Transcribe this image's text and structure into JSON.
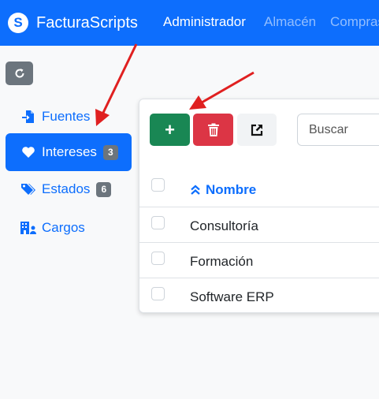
{
  "navbar": {
    "brand_name": "FacturaScripts",
    "items": [
      {
        "label": "Administrador",
        "active": true
      },
      {
        "label": "Almacén",
        "active": false
      },
      {
        "label": "Compras",
        "active": false
      }
    ]
  },
  "sidebar": {
    "items": [
      {
        "label": "Fuentes",
        "icon": "file-import-icon",
        "badge": "",
        "active": false
      },
      {
        "label": "Intereses",
        "icon": "heart-icon",
        "badge": "3",
        "active": true
      },
      {
        "label": "Estados",
        "icon": "tags-icon",
        "badge": "6",
        "active": false
      },
      {
        "label": "Cargos",
        "icon": "building-user-icon",
        "badge": "",
        "active": false
      }
    ]
  },
  "toolbar": {
    "add_label": "+",
    "search_placeholder": "Buscar"
  },
  "table": {
    "header": "Nombre",
    "sort": "ascending",
    "rows": [
      "Consultoría",
      "Formación",
      "Software ERP"
    ]
  },
  "colors": {
    "primary": "#0d6efd",
    "success": "#198754",
    "danger": "#dc3545",
    "secondary": "#6c757d",
    "annotation_arrow": "#e02020"
  }
}
